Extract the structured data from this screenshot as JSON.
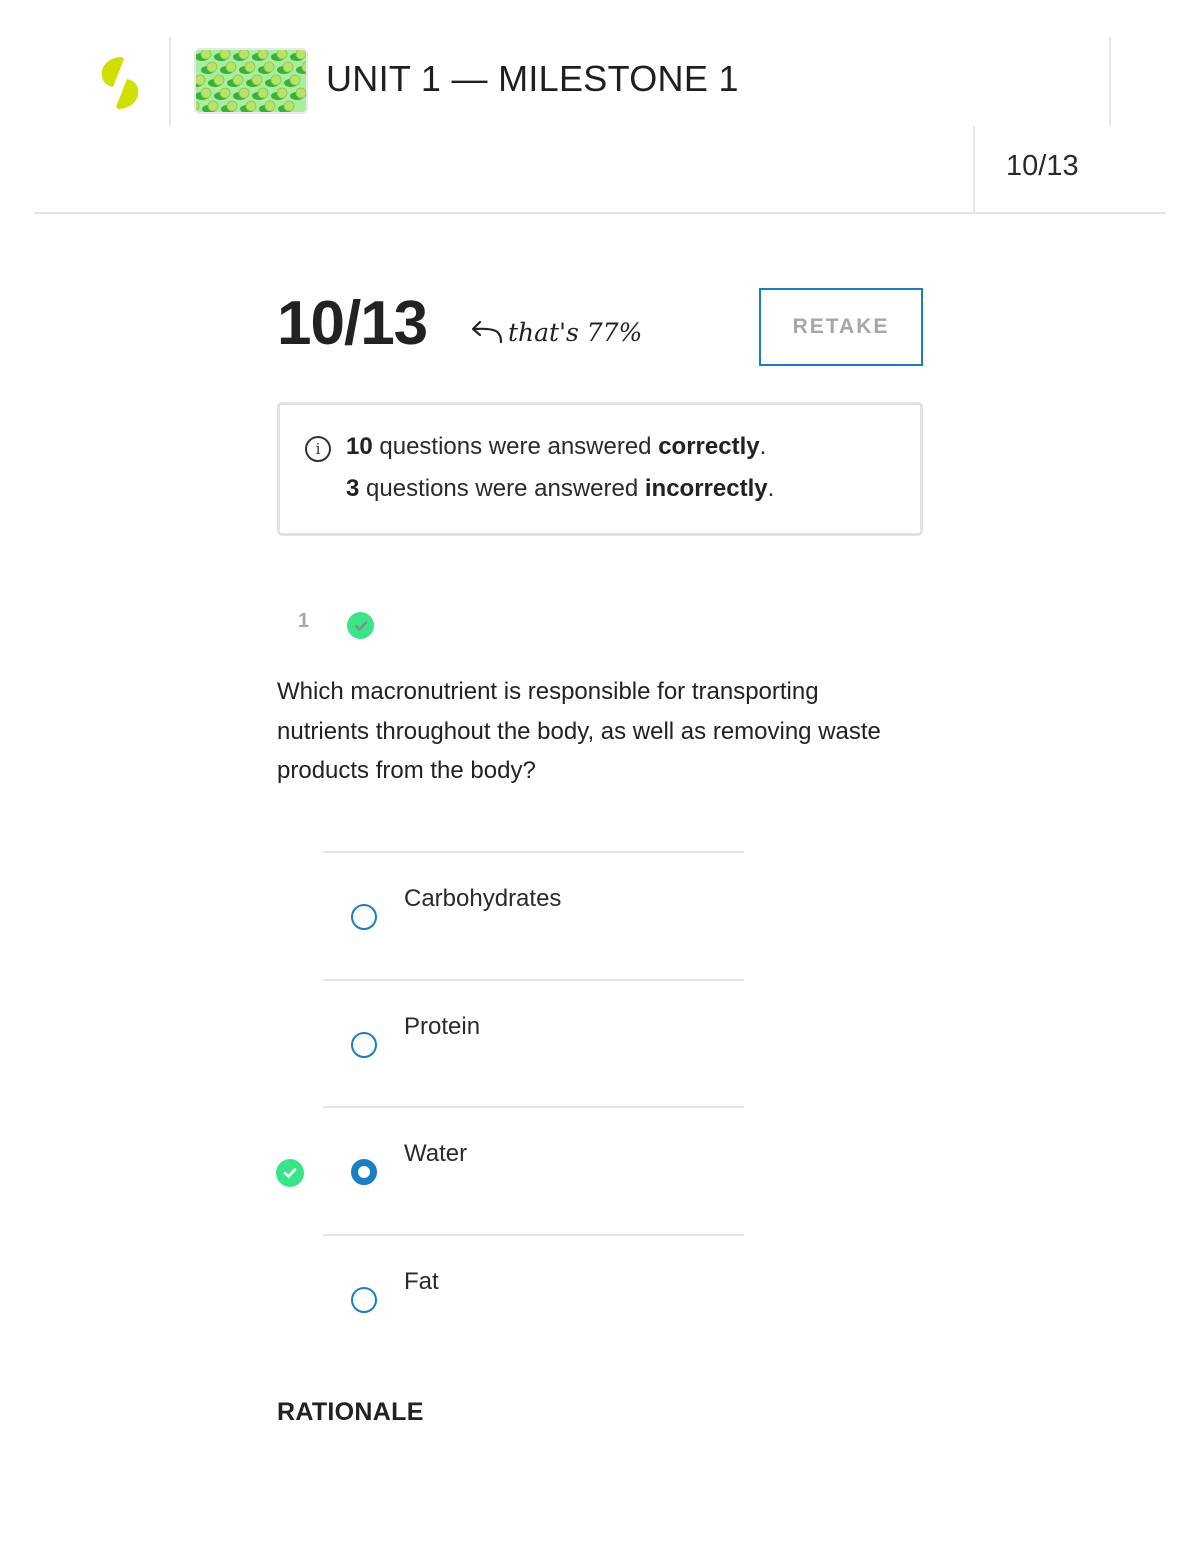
{
  "header": {
    "logo": "sophia-logo-icon",
    "thumbnail": "green-apples-thumbnail",
    "title": "UNIT 1 — MILESTONE 1",
    "score": "10/13"
  },
  "result": {
    "score": "10/13",
    "note": "that's 77%",
    "percent": 77,
    "retake_label": "RETAKE"
  },
  "summary": {
    "icon": "info-icon",
    "correct_count": "10",
    "correct_text": " questions were answered ",
    "correct_word": "correctly",
    "incorrect_count": "3",
    "incorrect_text": " questions were answered ",
    "incorrect_word": "incorrectly",
    "period": "."
  },
  "question": {
    "number": "1",
    "status": "correct",
    "text": "Which macronutrient is responsible for transporting nutrients throughout the body, as well as removing waste products from the body?",
    "options": [
      {
        "label": "Carbohydrates",
        "selected": false,
        "correct": false
      },
      {
        "label": "Protein",
        "selected": false,
        "correct": false
      },
      {
        "label": "Water",
        "selected": true,
        "correct": true
      },
      {
        "label": "Fat",
        "selected": false,
        "correct": false
      }
    ]
  },
  "rationale": {
    "heading": "RATIONALE"
  },
  "colors": {
    "accent_blue": "#1a7ec4",
    "correct_green": "#3ae488",
    "logo_yellow": "#cfe000"
  }
}
